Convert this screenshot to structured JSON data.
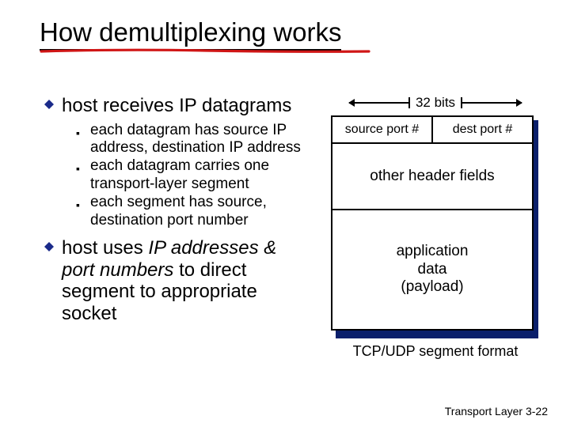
{
  "title": "How demultiplexing works",
  "left": {
    "b1": "host receives IP datagrams",
    "s1": "each datagram has source IP address, destination IP address",
    "s2": "each datagram carries one transport-layer segment",
    "s3": "each segment has source, destination port number",
    "b2a": "host uses ",
    "b2b": "IP addresses & port numbers",
    "b2c": " to direct segment to appropriate socket"
  },
  "diagram": {
    "bits": "32 bits",
    "src": "source port #",
    "dst": "dest port #",
    "other": "other header fields",
    "payload": "application\ndata\n(payload)",
    "caption": "TCP/UDP segment format"
  },
  "footer": {
    "label": "Transport Layer",
    "page": "3-22"
  }
}
